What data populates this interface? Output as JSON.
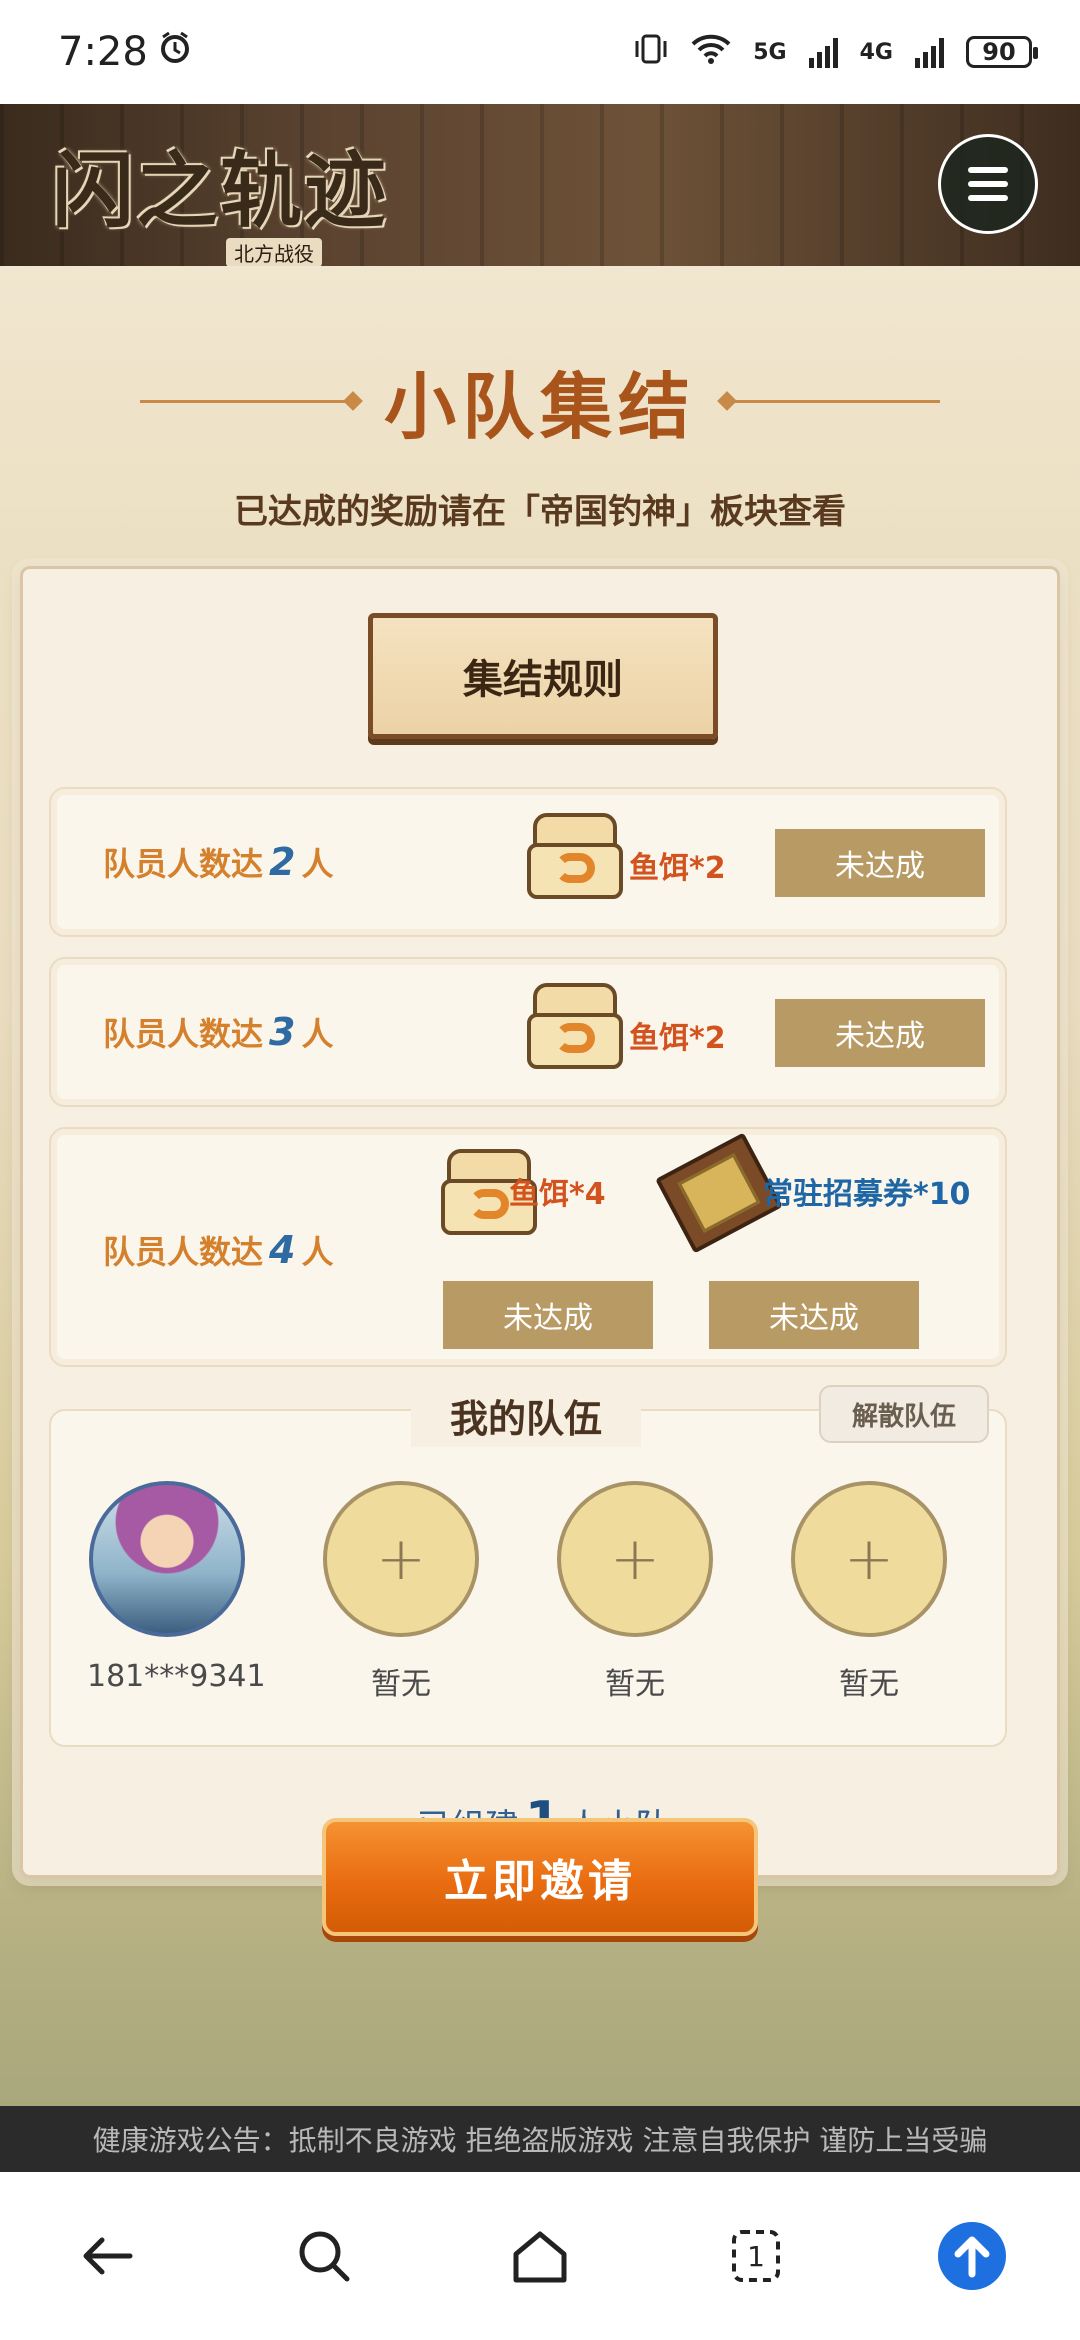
{
  "status_bar": {
    "time": "7:28",
    "network_5g": "5G",
    "network_4g": "4G",
    "battery": "90"
  },
  "header": {
    "logo_text": "闪之轨迹",
    "logo_subtext": "北方战役"
  },
  "page": {
    "title": "小队集结",
    "subtitle": "已达成的奖励请在「帝国钓神」板块查看",
    "rules_label": "集结规则"
  },
  "rules": [
    {
      "prefix": "队员人数达",
      "count": "2",
      "suffix": "人",
      "reward": "鱼饵*2",
      "status": "未达成"
    },
    {
      "prefix": "队员人数达",
      "count": "3",
      "suffix": "人",
      "reward": "鱼饵*2",
      "status": "未达成"
    },
    {
      "prefix": "队员人数达",
      "count": "4",
      "suffix": "人",
      "reward": "鱼饵*4",
      "status": "未达成",
      "reward2": "常驻招募券*10",
      "status2": "未达成"
    }
  ],
  "team": {
    "title": "我的队伍",
    "disband_label": "解散队伍",
    "members": [
      {
        "name": "181***9341"
      },
      {
        "name": "暂无",
        "slot": "+"
      },
      {
        "name": "暂无",
        "slot": "+"
      },
      {
        "name": "暂无",
        "slot": "+"
      }
    ],
    "count_prefix": "已组建",
    "count": "1",
    "count_suffix": "人小队"
  },
  "invite_label": "立即邀请",
  "notice": "健康游戏公告：抵制不良游戏 拒绝盗版游戏 注意自我保护 谨防上当受骗",
  "bottom_nav": {
    "tab_count": "1"
  },
  "colors": {
    "accent_orange": "#e96c10",
    "status_gray": "#b89a64",
    "title_brown": "#a8541b"
  }
}
